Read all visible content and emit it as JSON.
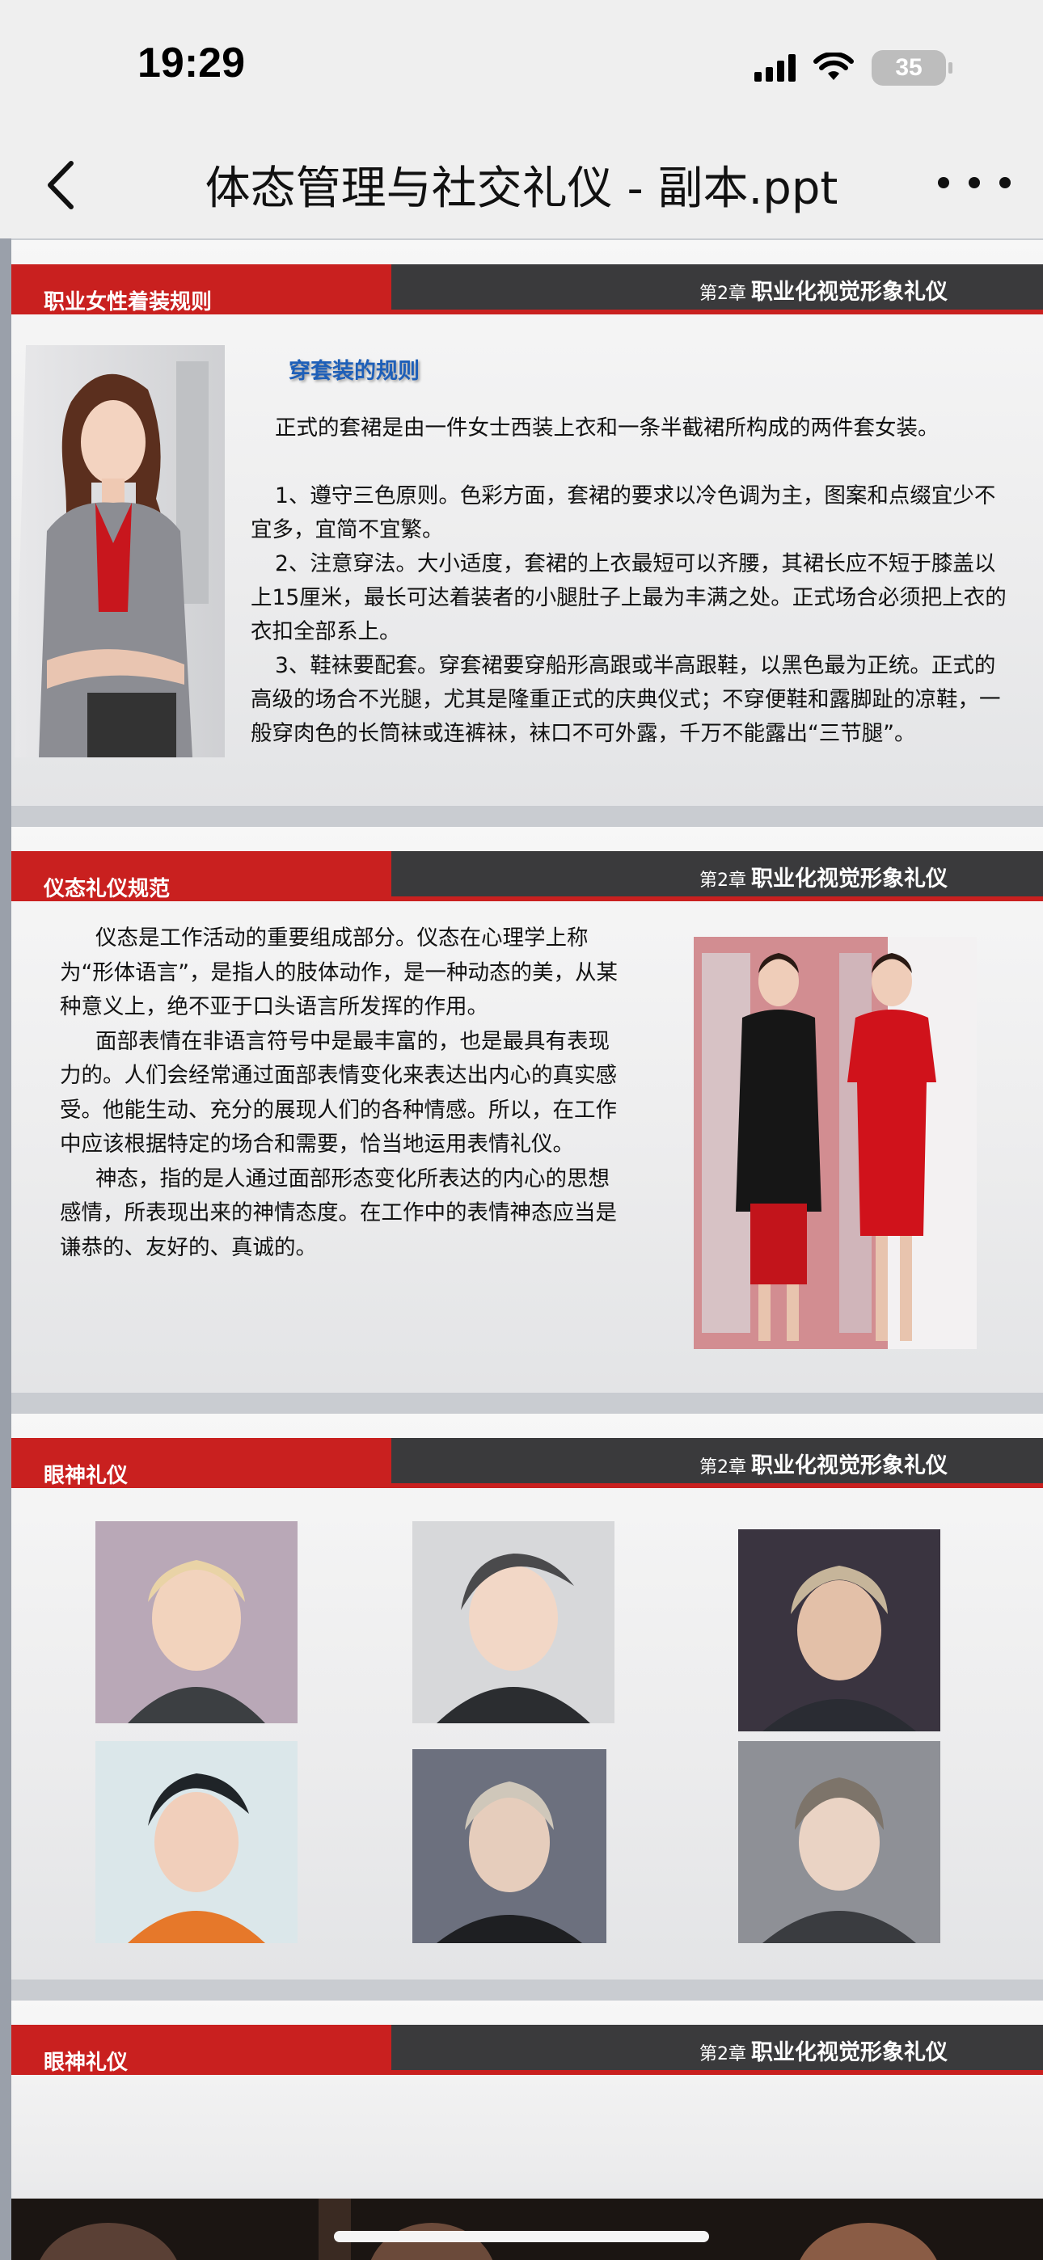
{
  "status_bar": {
    "time": "19:29",
    "battery": "35"
  },
  "nav": {
    "title": "体态管理与社交礼仪 - 副本.ppt"
  },
  "slides": [
    {
      "section_title": "职业女性着装规则",
      "chapter_small": "第2章",
      "chapter_title": "职业化视觉形象礼仪",
      "subtitle": "穿套装的规则",
      "paragraphs": [
        "正式的套裙是由一件女士西装上衣和一条半截裙所构成的两件套女装。",
        "1、遵守三色原则。色彩方面，套裙的要求以冷色调为主，图案和点缀宜少不宜多，宜简不宜繁。",
        "2、注意穿法。大小适度，套裙的上衣最短可以齐腰，其裙长应不短于膝盖以上15厘米，最长可达着装者的小腿肚子上最为丰满之处。正式场合必须把上衣的衣扣全部系上。",
        "3、鞋袜要配套。穿套裙要穿船形高跟或半高跟鞋，以黑色最为正统。正式的高级的场合不光腿，尤其是隆重正式的庆典仪式；不穿便鞋和露脚趾的凉鞋，一般穿肉色的长筒袜或连裤袜，袜口不可外露，千万不能露出“三节腿”。"
      ]
    },
    {
      "section_title": "仪态礼仪规范",
      "chapter_small": "第2章",
      "chapter_title": "职业化视觉形象礼仪",
      "paragraphs": [
        "仪态是工作活动的重要组成部分。仪态在心理学上称为“形体语言”，是指人的肢体动作，是一种动态的美，从某种意义上，绝不亚于口头语言所发挥的作用。",
        "面部表情在非语言符号中是最丰富的，也是最具有表现力的。人们会经常通过面部表情变化来表达出内心的真实感受。他能生动、充分的展现人们的各种情感。所以，在工作中应该根据特定的场合和需要，恰当地运用表情礼仪。",
        "神态，指的是人通过面部形态变化所表达的内心的思想感情，所表现出来的神情态度。在工作中的表情神态应当是谦恭的、友好的、真诚的。"
      ]
    },
    {
      "section_title": "眼神礼仪",
      "chapter_small": "第2章",
      "chapter_title": "职业化视觉形象礼仪"
    },
    {
      "section_title": "眼神礼仪",
      "chapter_small": "第2章",
      "chapter_title": "职业化视觉形象礼仪"
    }
  ],
  "colors": {
    "accent_red": "#c9201f",
    "header_dark": "#3a3a3c",
    "subtitle_blue": "#1e5fb8"
  }
}
